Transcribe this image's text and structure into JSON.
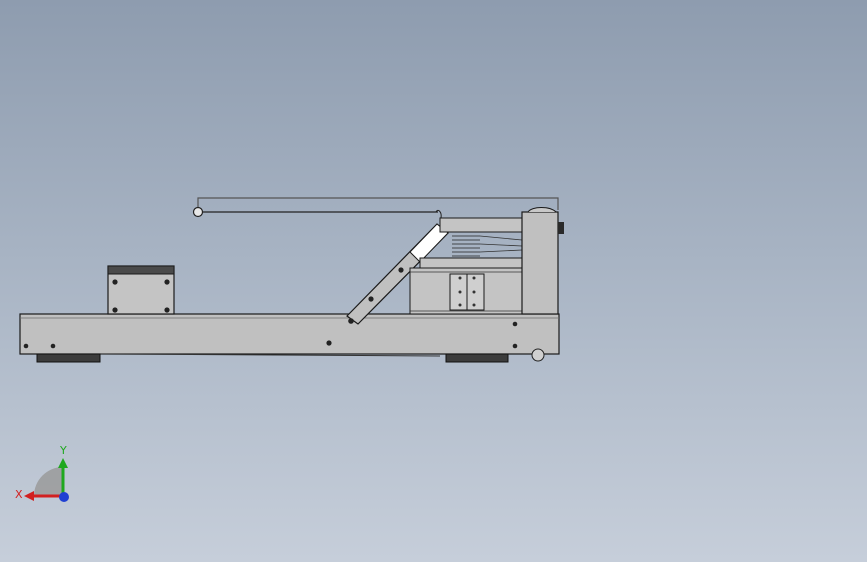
{
  "viewport": {
    "background_top": "#8e9caf",
    "background_bottom": "#c6ceda"
  },
  "model": {
    "frame_color": "#c0c0c0",
    "edge_color": "#1a1a1a",
    "foot_color": "#3c3c3c",
    "highlight_color": "#ffffff"
  },
  "triad": {
    "x_label": "X",
    "y_label": "Y",
    "x_color": "#d22020",
    "y_color": "#1fa81f",
    "z_color": "#1f3fd2"
  }
}
